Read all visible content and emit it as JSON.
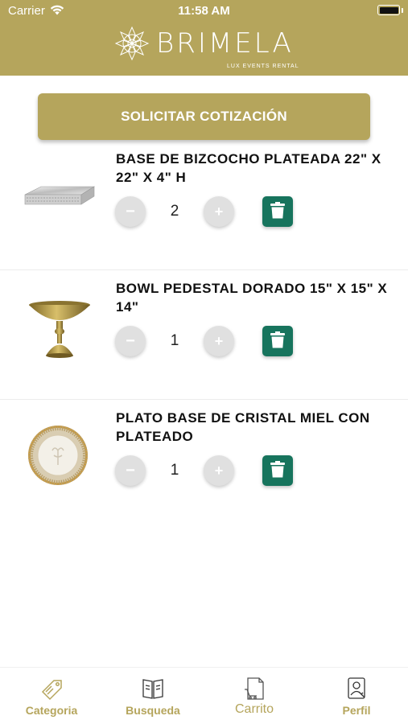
{
  "status_bar": {
    "carrier": "Carrier",
    "time": "11:58 AM"
  },
  "header": {
    "brand_name": "BRIMELA",
    "tagline": "LUX EVENTS RENTAL"
  },
  "actions": {
    "quote_button_label": "SOLICITAR COTIZACIÓN"
  },
  "cart": {
    "items": [
      {
        "title": "BASE DE BIZCOCHO PLATEADA 22\" X 22\" X 4\" H",
        "quantity": "2",
        "minus": "−",
        "plus": "+"
      },
      {
        "title": "BOWL PEDESTAL DORADO 15\" X 15\" X 14\"",
        "quantity": "1",
        "minus": "−",
        "plus": "+"
      },
      {
        "title": "PLATO BASE DE CRISTAL MIEL CON PLATEADO",
        "quantity": "1",
        "minus": "−",
        "plus": "+"
      }
    ]
  },
  "tab_bar": {
    "tabs": [
      {
        "label": "Categoria",
        "icon": "tag-icon"
      },
      {
        "label": "Busqueda",
        "icon": "book-icon"
      },
      {
        "label": "Carrito",
        "icon": "cart-document-icon"
      },
      {
        "label": "Perfil",
        "icon": "profile-icon"
      }
    ],
    "active": "Carrito"
  },
  "colors": {
    "brand_gold": "#b5a55c",
    "delete_green": "#17745d",
    "stepper_gray": "#e0e0e0"
  }
}
